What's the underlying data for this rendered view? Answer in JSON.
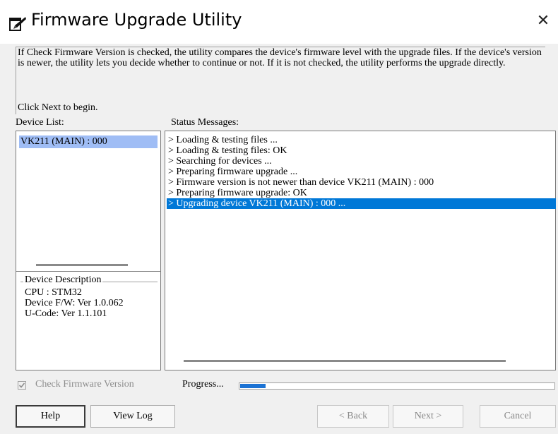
{
  "window": {
    "title": "Firmware Upgrade Utility",
    "close_glyph": "✕",
    "icon": "firmware-app-icon"
  },
  "intro": {
    "text": "If Check Firmware Version is checked, the utility compares the device's firmware level with the upgrade files. If the device's version is newer, the utility lets you decide whether to continue or not. If it is not checked, the utility performs the upgrade directly.",
    "begin": "Click Next to begin."
  },
  "device_list": {
    "label": "Device List:",
    "items": [
      "VK211 (MAIN) : 000"
    ]
  },
  "device_description": {
    "legend": "Device Description",
    "cpu": "CPU : STM32",
    "fw": "Device F/W: Ver 1.0.062",
    "ucode": "U-Code: Ver 1.1.101"
  },
  "status": {
    "label": "Status Messages:",
    "messages": [
      "> Loading & testing files ...",
      "> Loading & testing files: OK",
      "> Searching for devices ...",
      "> Preparing firmware upgrade ...",
      "> Firmware version is not newer than device VK211 (MAIN) : 000",
      "> Preparing firmware upgrade: OK",
      "> Upgrading device VK211 (MAIN) : 000 ..."
    ],
    "selected_index": 6
  },
  "options": {
    "check_firmware_label": "Check Firmware Version",
    "check_firmware_checked": true,
    "check_firmware_disabled": true
  },
  "progress": {
    "label": "Progress...",
    "fraction": 0.08
  },
  "buttons": {
    "help": "Help",
    "view_log": "View Log",
    "back": "< Back",
    "next": "Next >",
    "cancel": "Cancel"
  },
  "colors": {
    "selection": "#0078d7",
    "device_selection": "#9fbdf5",
    "progress": "#1c73d4"
  }
}
